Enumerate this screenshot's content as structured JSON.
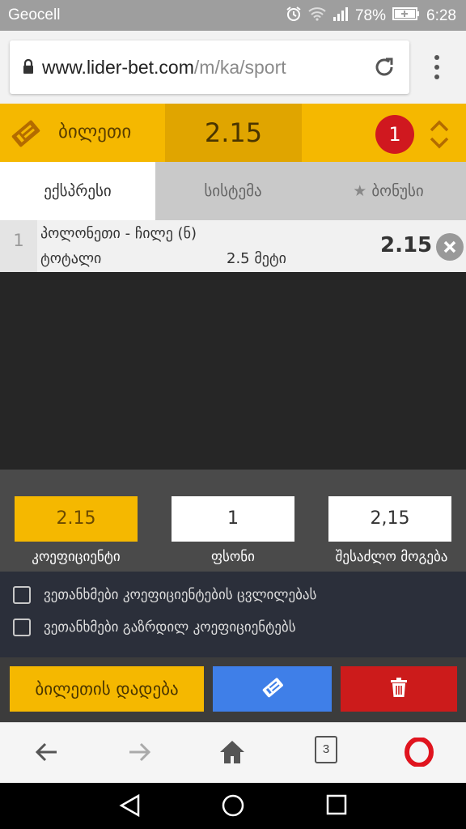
{
  "status_bar": {
    "carrier": "Geocell",
    "battery": "78%",
    "time": "6:28"
  },
  "browser": {
    "url_host": "www.lider-bet.com",
    "url_path": "/m/ka/sport",
    "tab_count": "3"
  },
  "ticket": {
    "label": "ბილეთი",
    "total_odds": "2.15",
    "selections_count": "1"
  },
  "tabs": [
    {
      "label": "ექსპრესი",
      "active": true
    },
    {
      "label": "სისტემა",
      "active": false
    },
    {
      "label": "ბონუსი",
      "active": false
    }
  ],
  "bets": [
    {
      "index": "1",
      "match": "პოლონეთი - ჩილე (ნ)",
      "market": "ტოტალი",
      "selection": "2.5 მეტი",
      "odds": "2.15"
    }
  ],
  "totals": {
    "odds_value": "2.15",
    "stake_value": "1",
    "win_value": "2,15",
    "odds_label": "კოეფიციენტი",
    "stake_label": "ფსონი",
    "win_label": "შესაძლო მოგება"
  },
  "agreements": [
    {
      "label": "ვეთანხმები კოეფიციენტების ცვლილებას",
      "checked": false
    },
    {
      "label": "ვეთანხმები გაზრდილ კოეფიციენტებს",
      "checked": false
    }
  ],
  "actions": {
    "place_label": "ბილეთის დადება"
  },
  "colors": {
    "accent": "#f5b800",
    "blue": "#3f7fe8",
    "red": "#cc1b1b",
    "badge": "#d0181f"
  }
}
